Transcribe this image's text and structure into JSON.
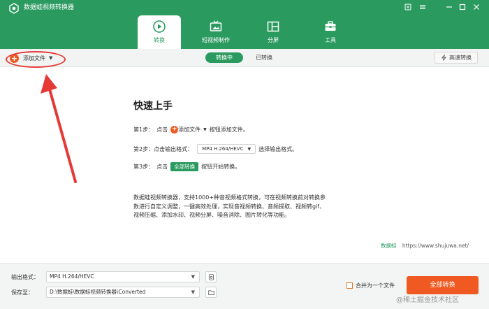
{
  "window": {
    "title": "数据蛙视频转换器",
    "controls": [
      "menu-icon",
      "feedback-icon",
      "minimize-icon",
      "maximize-icon",
      "close-icon"
    ]
  },
  "tabs": [
    {
      "label": "转换",
      "icon": "convert-icon",
      "active": true
    },
    {
      "label": "短视频制作",
      "icon": "tv-icon",
      "active": false
    },
    {
      "label": "分屏",
      "icon": "split-screen-icon",
      "active": false
    },
    {
      "label": "工具",
      "icon": "toolbox-icon",
      "active": false
    }
  ],
  "toolbar": {
    "add_file": "添加文件",
    "segments": [
      {
        "label": "转换中",
        "active": true
      },
      {
        "label": "已转换",
        "active": false
      }
    ],
    "fast_convert": "高速转换"
  },
  "quick_start": {
    "title": "快速上手",
    "step1": {
      "prefix": "第1步：",
      "click": "点击",
      "button": "添加文件",
      "suffix": "按钮添加文件。"
    },
    "step2": {
      "prefix": "第2步：",
      "text": "点击输出格式：",
      "format": "MP4 H.264/HEVC",
      "suffix": "选择输出格式。"
    },
    "step3": {
      "prefix": "第3步：",
      "click": "点击",
      "button": "全部转换",
      "suffix": "按钮开始转换。"
    }
  },
  "description": [
    "数据蛙视频转换器，支持1000+种音视频格式转换，可在视频转换前对转换参",
    "数进行自定义调整，一键高效处理，实现音视频转换、音频提取、视频转gif、",
    "视频压缩、添加水印、视频分屏、噪音消除、图片转化等功能。"
  ],
  "brand": {
    "name": "数据蛙",
    "url": "https://www.shujuwa.net/"
  },
  "bottom": {
    "output_format_label": "输出格式：",
    "output_format_value": "MP4 H.264/HEVC",
    "save_to_label": "保存至：",
    "save_to_value": "D:\\数据蛙\\数据蛙视频转换器\\Converted",
    "merge_label": "合并为一个文件",
    "merge_checked": false,
    "convert_all": "全部转换"
  },
  "watermark": "@稀土掘金技术社区",
  "colors": {
    "brand_green": "#2a9a5f",
    "accent_orange": "#f05a22",
    "annotation_red": "#e53935"
  }
}
